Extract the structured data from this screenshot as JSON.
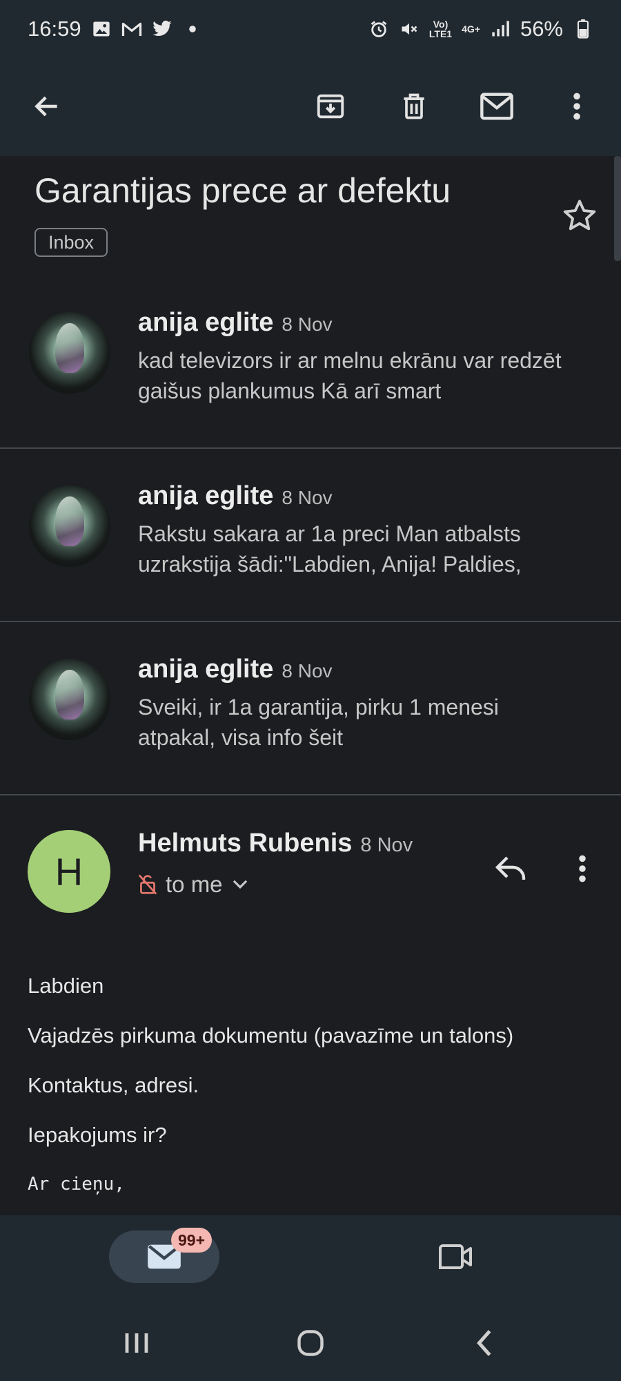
{
  "status_bar": {
    "time": "16:59",
    "network_top": "Vo)",
    "network_bottom": "LTE1",
    "network_type": "4G+",
    "battery": "56%",
    "left_icons": [
      "image-icon",
      "gmail-icon",
      "twitter-icon",
      "dot-icon"
    ],
    "right_icons": [
      "alarm-icon",
      "mute-icon",
      "signal-icon",
      "battery-icon"
    ]
  },
  "toolbar": {
    "actions": [
      "back-icon",
      "archive-icon",
      "delete-icon",
      "mark-unread-icon",
      "more-vert-icon"
    ]
  },
  "email": {
    "subject": "Garantijas prece ar defektu",
    "label": "Inbox"
  },
  "thread": [
    {
      "sender": "anija eglite",
      "date": "8 Nov",
      "snippet": "kad televizors ir ar melnu ekrānu var redzēt gaišus plankumus Kā arī smart"
    },
    {
      "sender": "anija eglite",
      "date": "8 Nov",
      "snippet": "Rakstu sakara ar 1a preci Man atbalsts uzrakstija šādi:\"Labdien, Anija! Paldies,"
    },
    {
      "sender": "anija eglite",
      "date": "8 Nov",
      "snippet": "Sveiki, ir 1a garantija, pirku 1 menesi atpakal, visa info šeit"
    }
  ],
  "open_message": {
    "avatar_letter": "H",
    "sender": "Helmuts Rubenis",
    "date": "8 Nov",
    "recipient": "to me",
    "body": [
      "Labdien",
      "Vajadzēs pirkuma dokumentu (pavazīme un talons)",
      "Kontaktus, adresi.",
      "Iepakojums ir?"
    ],
    "signature": "Ar cieņu,"
  },
  "bottom_nav": {
    "badge": "99+",
    "tabs": [
      "mail-icon",
      "video-icon"
    ]
  },
  "colors": {
    "background": "#1b1d20",
    "bar": "#212930",
    "avatar_green": "#a4cf76",
    "badge": "#f4b7b2",
    "mail_tab": "#38444f"
  }
}
